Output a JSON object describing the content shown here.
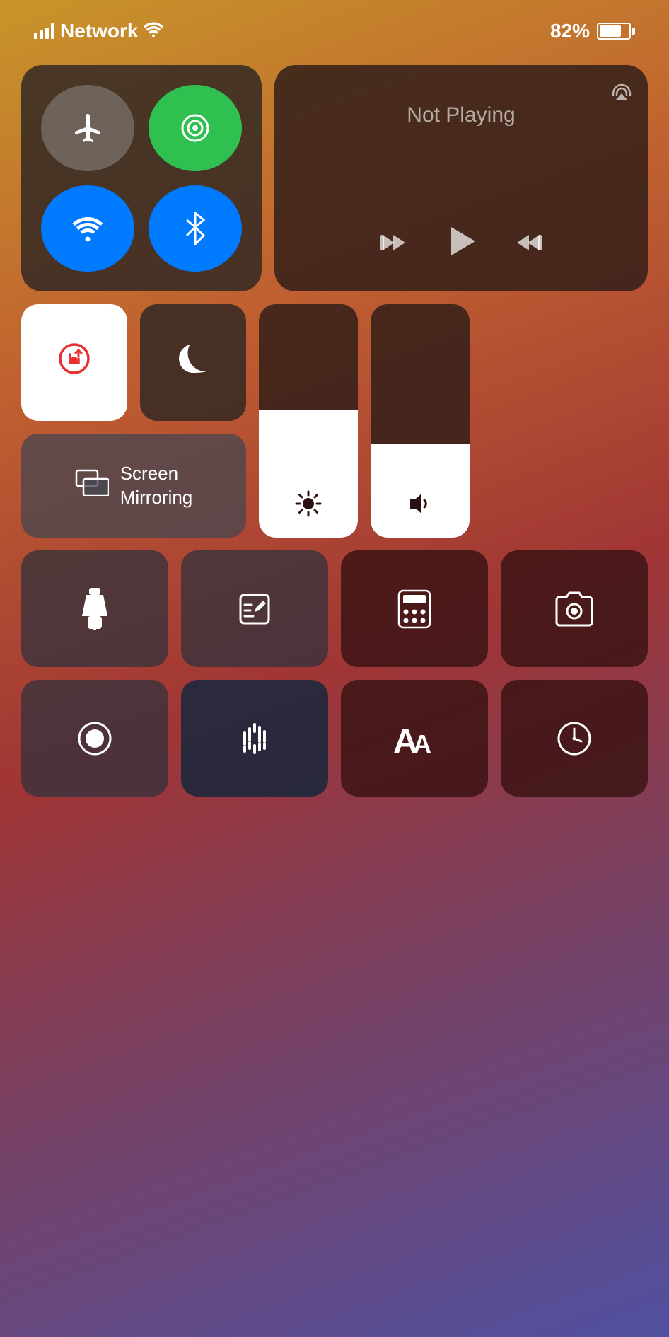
{
  "statusBar": {
    "network": "Network",
    "battery": "82%",
    "signalBars": 4
  },
  "connectivity": {
    "airplaneMode": "airplane-mode",
    "cellular": "cellular",
    "wifi": "wifi",
    "bluetooth": "bluetooth"
  },
  "media": {
    "notPlayingLabel": "Not Playing",
    "airplayLabel": "airplay"
  },
  "toggles": {
    "screenLockLabel": "screen-lock-rotation",
    "doNotDisturbLabel": "do-not-disturb",
    "screenMirroringLabel": "Screen\nMirroring"
  },
  "sliders": {
    "brightnessLabel": "brightness",
    "volumeLabel": "volume"
  },
  "actions": {
    "flashlightLabel": "flashlight",
    "noteLabel": "note",
    "calculatorLabel": "calculator",
    "cameraLabel": "camera",
    "screenRecordLabel": "screen-record",
    "soundLabel": "sound-recognition",
    "textSizeLabel": "text-size",
    "clockLabel": "clock"
  }
}
